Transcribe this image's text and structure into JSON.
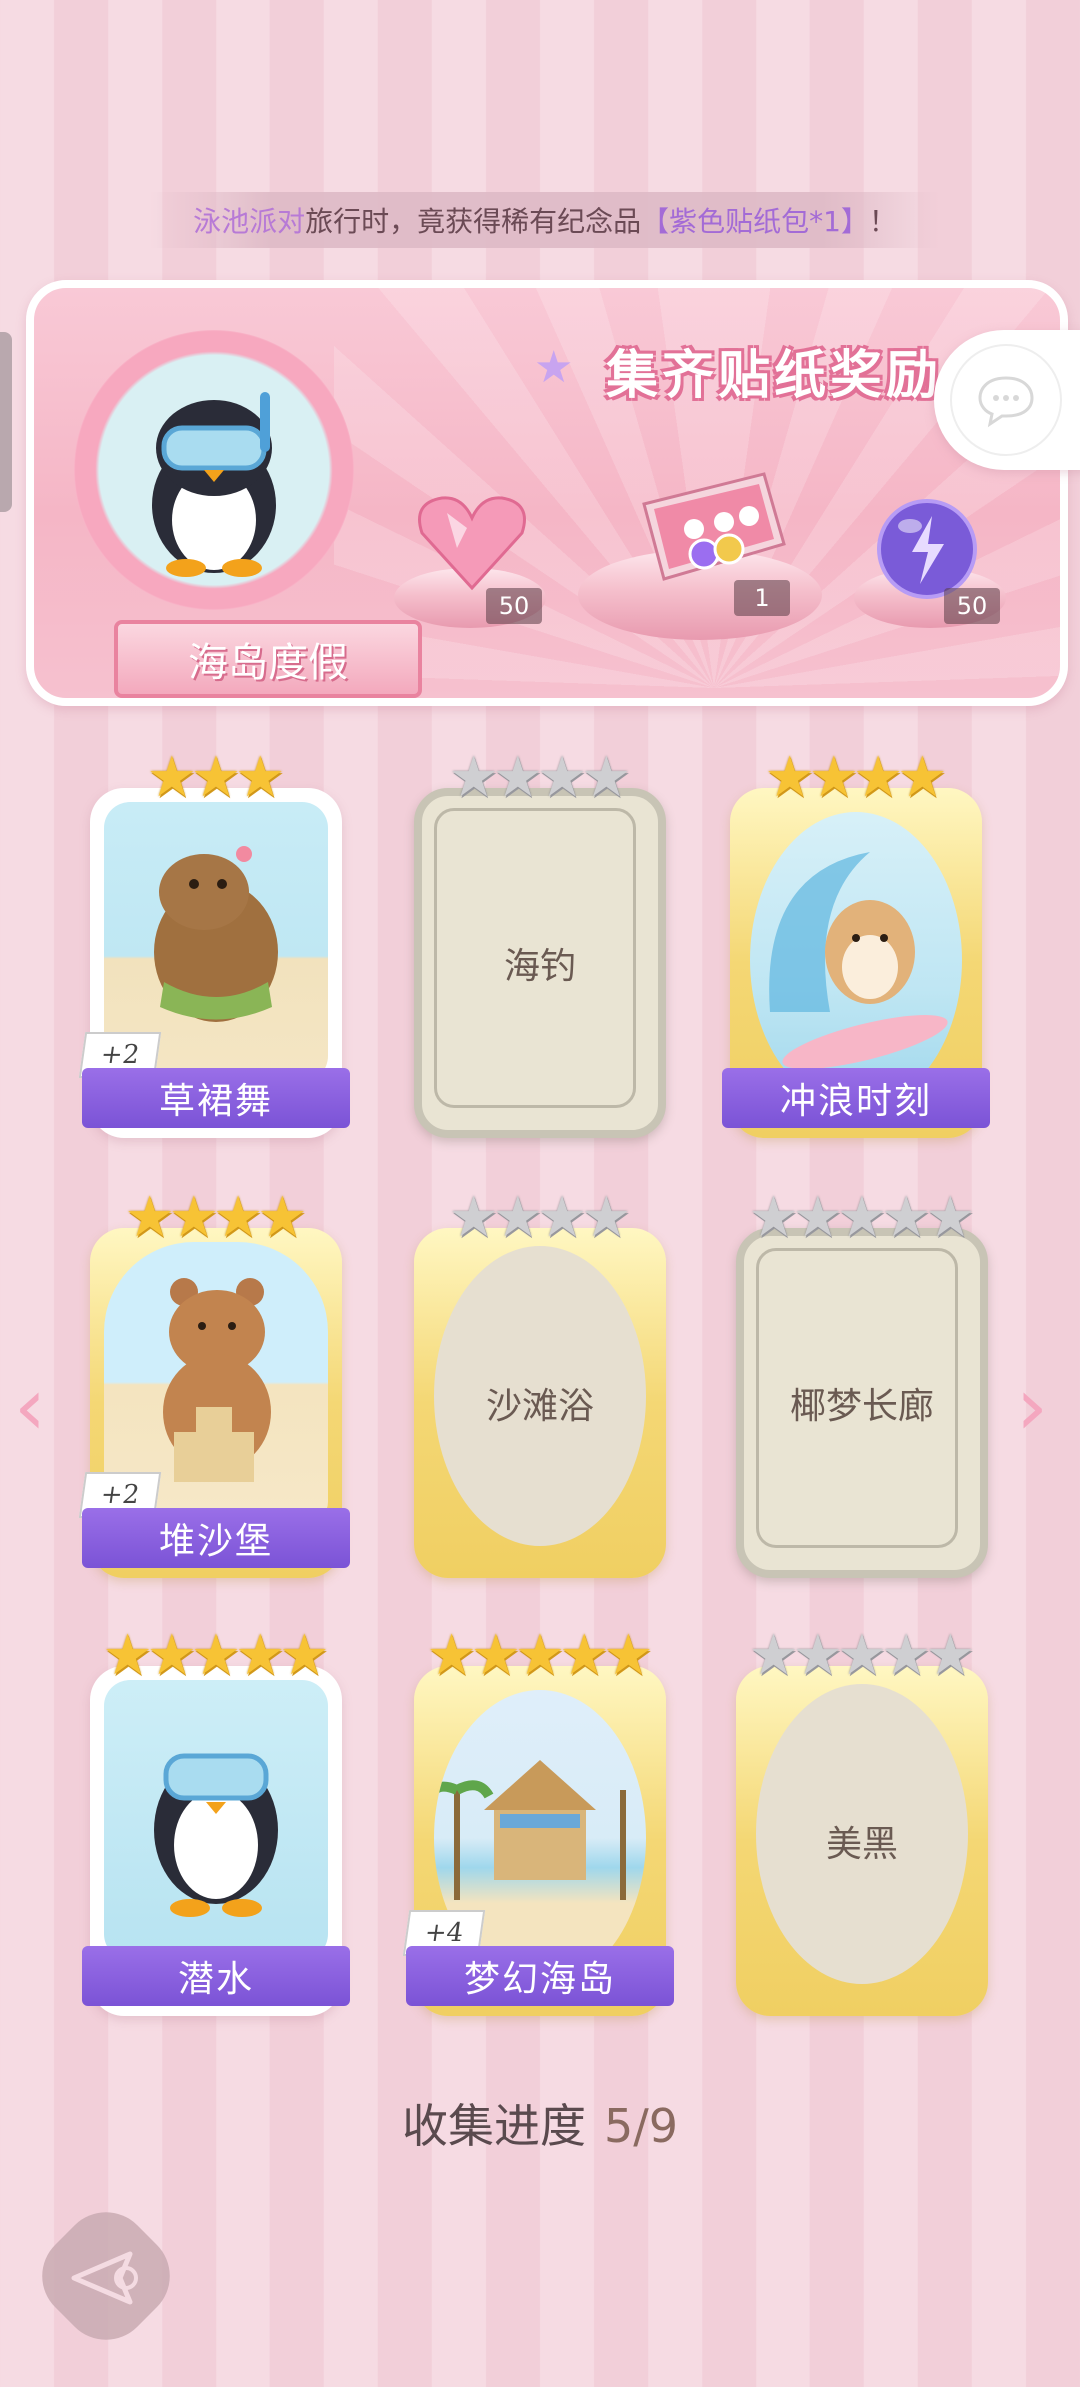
{
  "news": {
    "part1": "泳池派对",
    "part2": "旅行时，竟获得稀有纪念品",
    "part3": "【紫色贴纸包*1】",
    "part4": "！"
  },
  "reward_panel": {
    "title": "集齐贴纸奖励",
    "album_name": "海岛度假",
    "rewards": [
      {
        "icon": "pink-heart-gem-icon",
        "qty": "50"
      },
      {
        "icon": "sticker-gift-box-icon",
        "qty": "1"
      },
      {
        "icon": "purple-energy-orb-icon",
        "qty": "50"
      }
    ]
  },
  "cards": [
    {
      "name": "草裙舞",
      "stars": 3,
      "unlocked": true,
      "bonus": "+2",
      "style": "white"
    },
    {
      "name": "海钓",
      "stars": 4,
      "unlocked": false,
      "style": "silver"
    },
    {
      "name": "冲浪时刻",
      "stars": 4,
      "unlocked": true,
      "style": "gold"
    },
    {
      "name": "堆沙堡",
      "stars": 4,
      "unlocked": true,
      "bonus": "+2",
      "style": "gold"
    },
    {
      "name": "沙滩浴",
      "stars": 4,
      "unlocked": false,
      "style": "gold-oval"
    },
    {
      "name": "椰梦长廊",
      "stars": 5,
      "unlocked": false,
      "style": "silver"
    },
    {
      "name": "潜水",
      "stars": 5,
      "unlocked": true,
      "style": "white"
    },
    {
      "name": "梦幻海岛",
      "stars": 5,
      "unlocked": true,
      "bonus": "+4",
      "style": "gold"
    },
    {
      "name": "美黑",
      "stars": 5,
      "unlocked": false,
      "style": "gold-oval"
    }
  ],
  "progress": {
    "label": "收集进度",
    "value": "5/9"
  },
  "colors": {
    "accent_purple": "#8a60e0",
    "star_gold": "#f7c335",
    "background_pink": "#f6dbe3"
  }
}
